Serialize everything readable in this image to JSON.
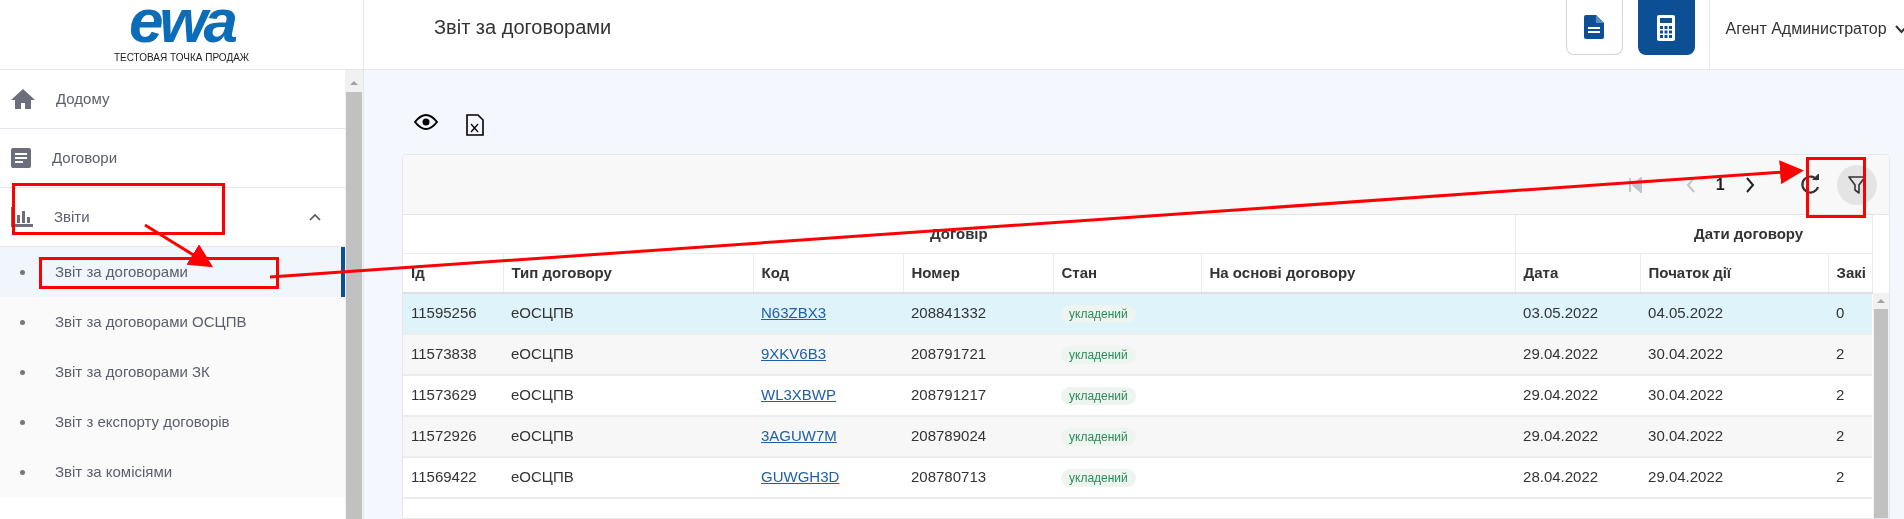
{
  "logo": {
    "brand": "ewa",
    "tagline": "ТЕСТОВАЯ ТОЧКА ПРОДАЖ"
  },
  "sidebar": {
    "items": [
      {
        "label": "Додому",
        "selected": false
      },
      {
        "label": "Договори",
        "selected": false
      },
      {
        "label": "Звіти",
        "expanded": true,
        "selected": false,
        "children": [
          {
            "label": "Звіт за договорами",
            "selected": true
          },
          {
            "label": "Звіт за договорами ОСЦПВ",
            "selected": false
          },
          {
            "label": "Звіт за договорами ЗК",
            "selected": false
          },
          {
            "label": "Звіт з експорту договорів",
            "selected": false
          },
          {
            "label": "Звіт за комісіями",
            "selected": false
          }
        ]
      }
    ]
  },
  "header": {
    "title": "Звіт за договорами",
    "user": "Агент Администратор"
  },
  "pagination": {
    "page": "1"
  },
  "table": {
    "groups": [
      {
        "label": "Договір"
      },
      {
        "label": "Дати договору"
      }
    ],
    "columns": [
      "Ід",
      "Тип договору",
      "Код",
      "Номер",
      "Стан",
      "На основі договору",
      "Дата",
      "Початок дії",
      "Закі"
    ],
    "rows": [
      {
        "selected": true,
        "cells": [
          "11595256",
          "еОСЦПВ",
          "N63ZBX3",
          "208841332",
          "укладений",
          "",
          "03.05.2022",
          "04.05.2022",
          "0"
        ]
      },
      {
        "selected": false,
        "cells": [
          "11573838",
          "еОСЦПВ",
          "9XKV6B3",
          "208791721",
          "укладений",
          "",
          "29.04.2022",
          "30.04.2022",
          "2"
        ]
      },
      {
        "selected": false,
        "cells": [
          "11573629",
          "еОСЦПВ",
          "WL3XBWP",
          "208791217",
          "укладений",
          "",
          "29.04.2022",
          "30.04.2022",
          "2"
        ]
      },
      {
        "selected": false,
        "cells": [
          "11572926",
          "еОСЦПВ",
          "3AGUW7M",
          "208789024",
          "укладений",
          "",
          "29.04.2022",
          "30.04.2022",
          "2"
        ]
      },
      {
        "selected": false,
        "cells": [
          "11569422",
          "еОСЦПВ",
          "GUWGH3D",
          "208780713",
          "укладений",
          "",
          "28.04.2022",
          "29.04.2022",
          "2"
        ]
      }
    ]
  }
}
